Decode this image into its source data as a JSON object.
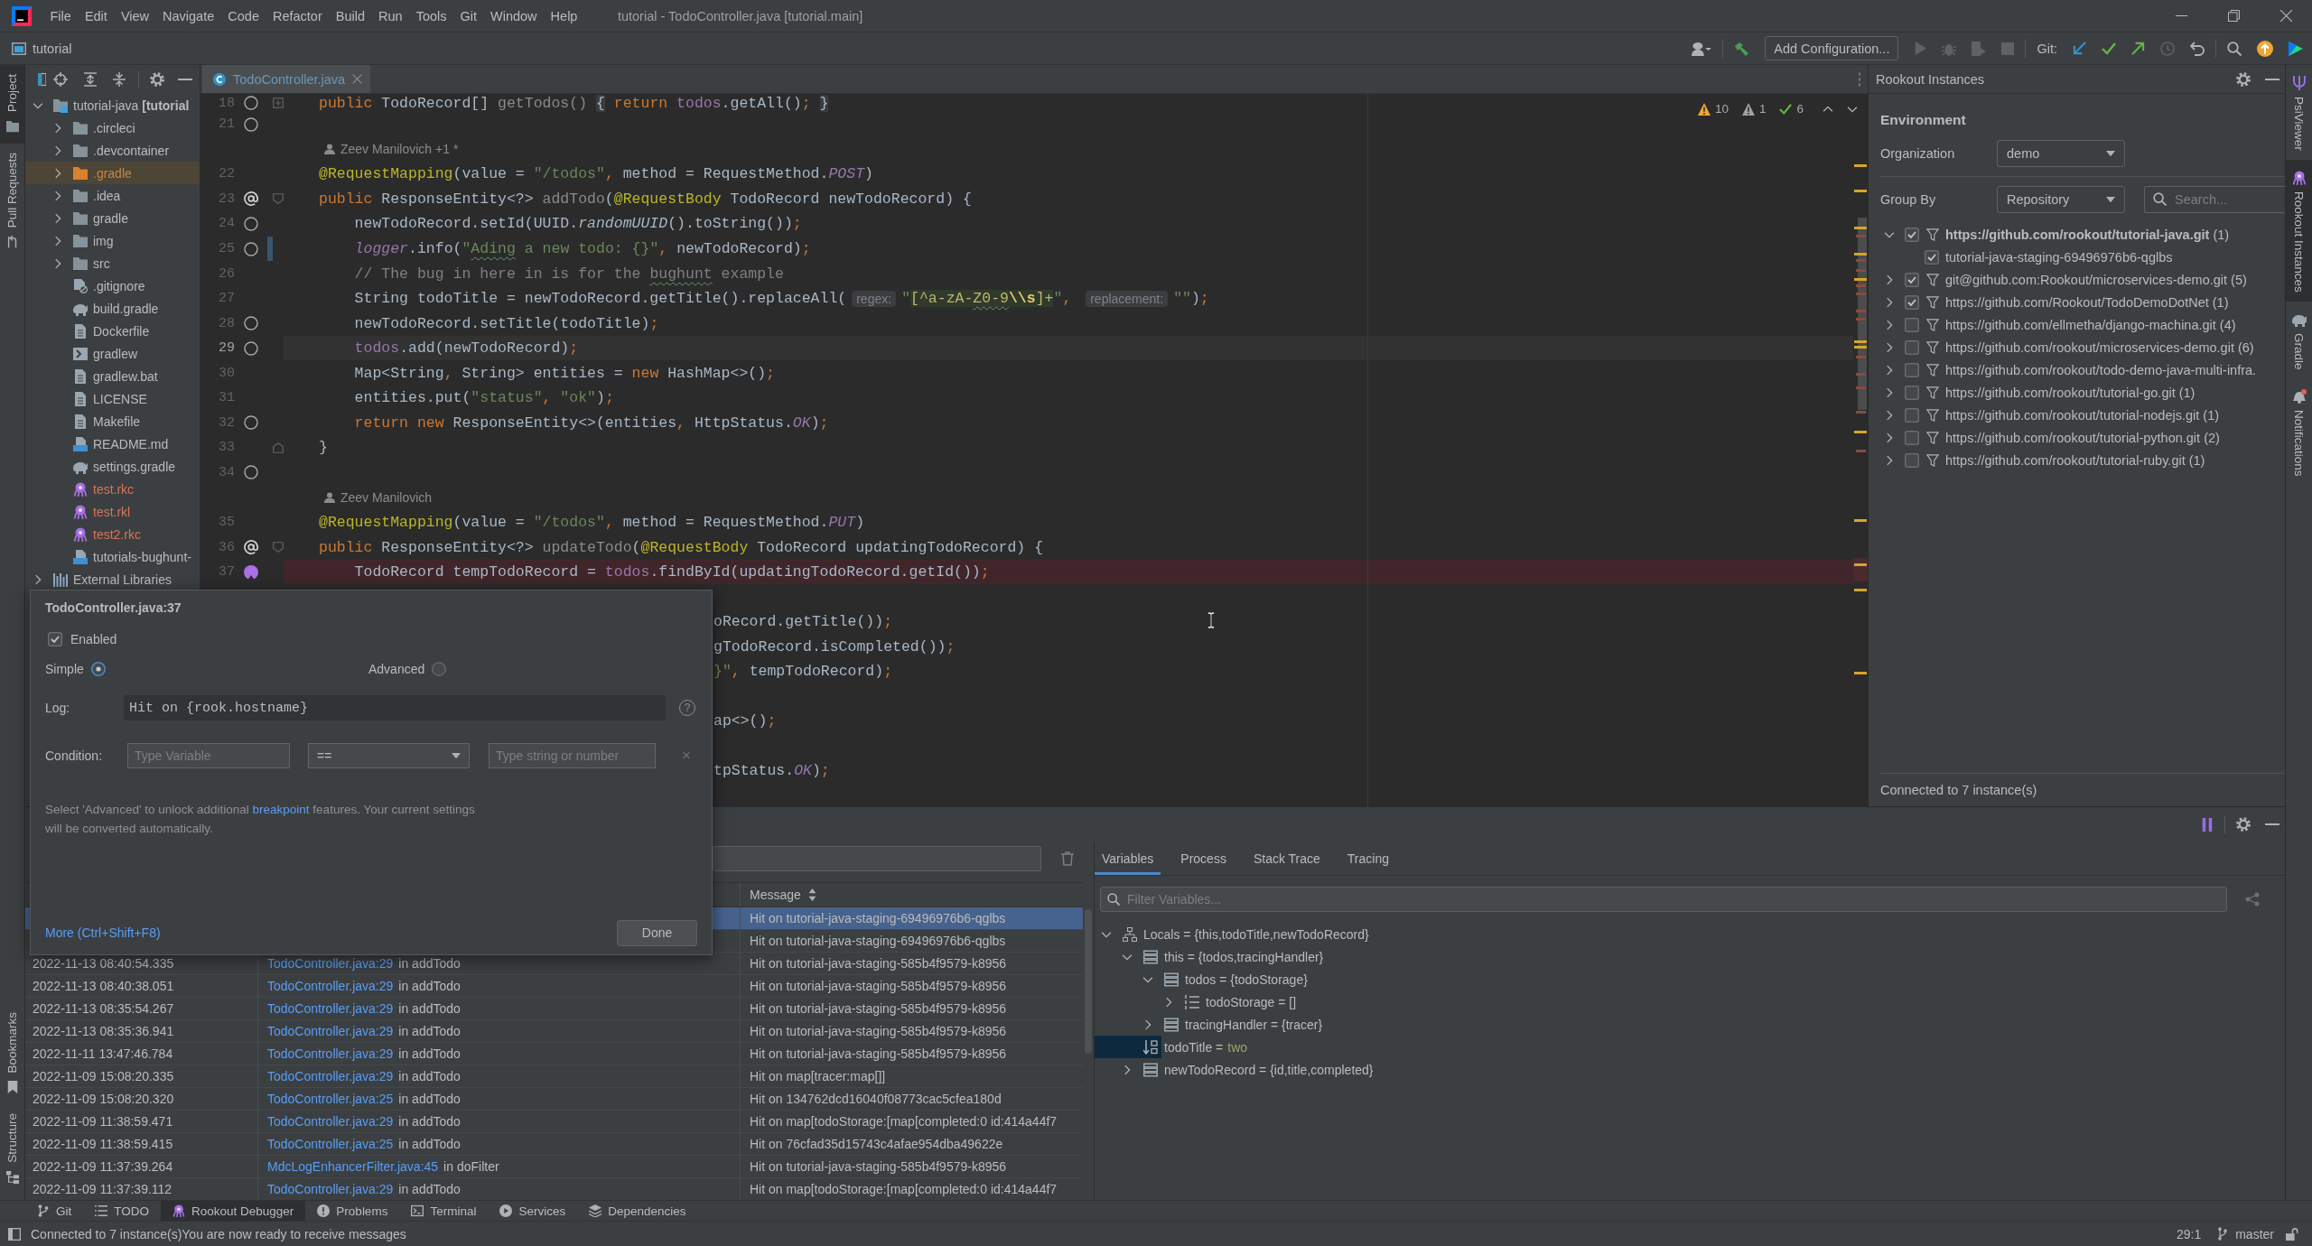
{
  "title_bar": {
    "menu": [
      "File",
      "Edit",
      "View",
      "Navigate",
      "Code",
      "Refactor",
      "Build",
      "Run",
      "Tools",
      "Git",
      "Window",
      "Help"
    ],
    "title": "tutorial - TodoController.java [tutorial.main]"
  },
  "nav_bar": {
    "project": "tutorial",
    "run_configuration": "Add Configuration...",
    "git_label": "Git:"
  },
  "left_strip": {
    "top": [
      {
        "label": "Project",
        "kind": "project",
        "selected": true
      },
      {
        "label": "Pull Requests",
        "kind": "pull-requests",
        "selected": false
      }
    ],
    "bottom": [
      {
        "label": "Bookmarks",
        "kind": "bookmarks",
        "selected": false
      },
      {
        "label": "Structure",
        "kind": "structure",
        "selected": false
      }
    ]
  },
  "project_panel": {
    "tree": [
      {
        "label": "tutorial-java **[tutorial**",
        "kind": "module",
        "expanded": true,
        "excluded": false,
        "unversioned": false,
        "children": [
          {
            "label": ".circleci",
            "kind": "folder",
            "expanded": false,
            "excluded": false,
            "unversioned": false
          },
          {
            "label": ".devcontainer",
            "kind": "folder",
            "expanded": false,
            "excluded": false,
            "unversioned": false
          },
          {
            "label": ".gradle",
            "kind": "folder",
            "expanded": false,
            "excluded": true,
            "unversioned": false
          },
          {
            "label": ".idea",
            "kind": "folder",
            "expanded": false,
            "excluded": false,
            "unversioned": false
          },
          {
            "label": "gradle",
            "kind": "folder",
            "expanded": false,
            "excluded": false,
            "unversioned": false
          },
          {
            "label": "img",
            "kind": "folder",
            "expanded": false,
            "excluded": false,
            "unversioned": false
          },
          {
            "label": "src",
            "kind": "folder",
            "expanded": false,
            "excluded": false,
            "unversioned": false
          },
          {
            "label": ".gitignore",
            "kind": "ignore-file",
            "excluded": false,
            "unversioned": false
          },
          {
            "label": "build.gradle",
            "kind": "gradle",
            "excluded": false,
            "unversioned": false
          },
          {
            "label": "Dockerfile",
            "kind": "text",
            "excluded": false,
            "unversioned": false
          },
          {
            "label": "gradlew",
            "kind": "script",
            "excluded": false,
            "unversioned": false
          },
          {
            "label": "gradlew.bat",
            "kind": "text",
            "excluded": false,
            "unversioned": false
          },
          {
            "label": "LICENSE",
            "kind": "text",
            "excluded": false,
            "unversioned": false
          },
          {
            "label": "Makefile",
            "kind": "text",
            "excluded": false,
            "unversioned": false
          },
          {
            "label": "README.md",
            "kind": "markdown",
            "excluded": false,
            "unversioned": false
          },
          {
            "label": "settings.gradle",
            "kind": "gradle",
            "excluded": false,
            "unversioned": false
          },
          {
            "label": "test.rkc",
            "kind": "rookout",
            "excluded": false,
            "unversioned": true
          },
          {
            "label": "test.rkl",
            "kind": "rookout",
            "excluded": false,
            "unversioned": true
          },
          {
            "label": "test2.rkc",
            "kind": "rookout",
            "excluded": false,
            "unversioned": true
          },
          {
            "label": "tutorials-bughunt-",
            "kind": "markdown",
            "excluded": false,
            "unversioned": false
          }
        ]
      },
      {
        "label": "External Libraries",
        "kind": "library",
        "expanded": false,
        "excluded": false,
        "unversioned": false
      }
    ]
  },
  "editor": {
    "tab": {
      "label": "TodoController.java",
      "modified": true
    },
    "inspections": [
      {
        "kind": "warning",
        "count": "10"
      },
      {
        "kind": "weak-warning",
        "count": "1"
      },
      {
        "kind": "ok",
        "count": "6"
      }
    ],
    "lines": [
      {
        "kind": "code",
        "number": "18",
        "gutter": {
          "kind": "ring"
        },
        "fold": {
          "kind": "collapsed"
        },
        "segments": [
          {
            "text": "public ",
            "kind": "keyword"
          },
          {
            "text": "TodoRecord[] ",
            "kind": "plain"
          },
          {
            "text": "getTodos() ",
            "kind": "unused"
          },
          {
            "text": "{",
            "kind": "folded"
          },
          {
            "text": " return ",
            "kind": "keyword"
          },
          {
            "text": "todos",
            "kind": "field"
          },
          {
            "text": ".getAll()",
            "kind": "plain"
          },
          {
            "text": "; ",
            "kind": "keyword"
          },
          {
            "text": "}",
            "kind": "folded"
          }
        ]
      },
      {
        "kind": "code",
        "number": "21",
        "gutter": {
          "kind": "ring"
        }
      },
      {
        "kind": "author",
        "text": "Zeev Manilovich +1 *"
      },
      {
        "kind": "code",
        "number": "22",
        "segments": [
          {
            "text": "@RequestMapping",
            "kind": "annotation"
          },
          {
            "text": "(value = ",
            "kind": "plain"
          },
          {
            "text": "\"/todos\"",
            "kind": "string"
          },
          {
            "text": ", ",
            "kind": "keyword"
          },
          {
            "text": "method = RequestMethod.",
            "kind": "plain"
          },
          {
            "text": "POST",
            "kind": "constant"
          },
          {
            "text": ")",
            "kind": "plain"
          }
        ]
      },
      {
        "kind": "code",
        "number": "23",
        "gutter": {
          "kind": "mapping"
        },
        "fold": {
          "kind": "start"
        },
        "segments": [
          {
            "text": "public ",
            "kind": "keyword"
          },
          {
            "text": "ResponseEntity<?> ",
            "kind": "plain"
          },
          {
            "text": "addTodo",
            "kind": "unused"
          },
          {
            "text": "(",
            "kind": "plain"
          },
          {
            "text": "@RequestBody ",
            "kind": "annotation"
          },
          {
            "text": "TodoRecord newTodoRecord) {",
            "kind": "plain"
          }
        ]
      },
      {
        "kind": "code",
        "number": "24",
        "gutter": {
          "kind": "ring"
        },
        "segments": [
          {
            "text": "    newTodoRecord.setId(UUID.",
            "kind": "plain"
          },
          {
            "text": "randomUUID",
            "kind": "static-call"
          },
          {
            "text": "().toString())",
            "kind": "plain"
          },
          {
            "text": ";",
            "kind": "keyword"
          }
        ]
      },
      {
        "kind": "code",
        "number": "25",
        "gutter": {
          "kind": "ring"
        },
        "vcs": {
          "kind": "modified"
        },
        "segments": [
          {
            "text": "    logger",
            "kind": "constant"
          },
          {
            "text": ".info(",
            "kind": "plain"
          },
          {
            "text": "\"",
            "kind": "string"
          },
          {
            "text": "Ading",
            "kind": "string-typo"
          },
          {
            "text": " a new todo: {}\"",
            "kind": "string"
          },
          {
            "text": ", ",
            "kind": "keyword"
          },
          {
            "text": "newTodoRecord)",
            "kind": "plain"
          },
          {
            "text": ";",
            "kind": "keyword"
          }
        ]
      },
      {
        "kind": "code",
        "number": "26",
        "segments": [
          {
            "text": "    // The bug in here in is for the ",
            "kind": "comment"
          },
          {
            "text": "bughunt",
            "kind": "comment-typo"
          },
          {
            "text": " example",
            "kind": "comment"
          }
        ]
      },
      {
        "kind": "code",
        "number": "27",
        "segments": [
          {
            "text": "    String todoTitle = newTodoRecord.getTitle().replaceAll(",
            "kind": "plain"
          },
          {
            "text": "regex:",
            "kind": "hint"
          },
          {
            "text": "\"",
            "kind": "string"
          },
          {
            "text": "[^a-zA-",
            "kind": "regex"
          },
          {
            "text": "Z0-9",
            "kind": "regex-typo"
          },
          {
            "text": "\\\\s",
            "kind": "regex-escape"
          },
          {
            "text": "]+",
            "kind": "regex"
          },
          {
            "text": "\"",
            "kind": "string"
          },
          {
            "text": ", ",
            "kind": "keyword"
          },
          {
            "text": "replacement:",
            "kind": "hint"
          },
          {
            "text": "\"\"",
            "kind": "string"
          },
          {
            "text": ")",
            "kind": "plain"
          },
          {
            "text": ";",
            "kind": "keyword"
          }
        ]
      },
      {
        "kind": "code",
        "number": "28",
        "gutter": {
          "kind": "ring"
        },
        "segments": [
          {
            "text": "    newTodoRecord.setTitle(todoTitle)",
            "kind": "plain"
          },
          {
            "text": ";",
            "kind": "keyword"
          }
        ]
      },
      {
        "kind": "code",
        "number": "29",
        "gutter": {
          "kind": "ring"
        },
        "highlight": {
          "kind": "caret"
        },
        "segments": [
          {
            "text": "    todos",
            "kind": "field"
          },
          {
            "text": ".add(newTodoRecord)",
            "kind": "plain"
          },
          {
            "text": ";",
            "kind": "keyword"
          }
        ]
      },
      {
        "kind": "code",
        "number": "30",
        "segments": [
          {
            "text": "    Map<String",
            "kind": "plain"
          },
          {
            "text": ", ",
            "kind": "keyword"
          },
          {
            "text": "String> entities = ",
            "kind": "plain"
          },
          {
            "text": "new ",
            "kind": "keyword"
          },
          {
            "text": "HashMap<>()",
            "kind": "plain"
          },
          {
            "text": ";",
            "kind": "keyword"
          }
        ]
      },
      {
        "kind": "code",
        "number": "31",
        "segments": [
          {
            "text": "    entities.put(",
            "kind": "plain"
          },
          {
            "text": "\"status\"",
            "kind": "string"
          },
          {
            "text": ", ",
            "kind": "keyword"
          },
          {
            "text": "\"ok\"",
            "kind": "string"
          },
          {
            "text": ")",
            "kind": "plain"
          },
          {
            "text": ";",
            "kind": "keyword"
          }
        ]
      },
      {
        "kind": "code",
        "number": "32",
        "gutter": {
          "kind": "ring"
        },
        "segments": [
          {
            "text": "    return new ",
            "kind": "keyword"
          },
          {
            "text": "ResponseEntity<>(entities",
            "kind": "plain"
          },
          {
            "text": ", ",
            "kind": "keyword"
          },
          {
            "text": "HttpStatus.",
            "kind": "plain"
          },
          {
            "text": "OK",
            "kind": "constant"
          },
          {
            "text": ")",
            "kind": "plain"
          },
          {
            "text": ";",
            "kind": "keyword"
          }
        ]
      },
      {
        "kind": "code",
        "number": "33",
        "fold": {
          "kind": "end"
        },
        "segments": [
          {
            "text": "}",
            "kind": "plain"
          }
        ]
      },
      {
        "kind": "code",
        "number": "34",
        "gutter": {
          "kind": "ring"
        }
      },
      {
        "kind": "author",
        "text": "Zeev Manilovich"
      },
      {
        "kind": "code",
        "number": "35",
        "segments": [
          {
            "text": "@RequestMapping",
            "kind": "annotation"
          },
          {
            "text": "(value = ",
            "kind": "plain"
          },
          {
            "text": "\"/todos\"",
            "kind": "string"
          },
          {
            "text": ", ",
            "kind": "keyword"
          },
          {
            "text": "method = RequestMethod.",
            "kind": "plain"
          },
          {
            "text": "PUT",
            "kind": "constant"
          },
          {
            "text": ")",
            "kind": "plain"
          }
        ]
      },
      {
        "kind": "code",
        "number": "36",
        "gutter": {
          "kind": "mapping"
        },
        "fold": {
          "kind": "start"
        },
        "segments": [
          {
            "text": "public ",
            "kind": "keyword"
          },
          {
            "text": "ResponseEntity<?> ",
            "kind": "plain"
          },
          {
            "text": "updateTodo",
            "kind": "unused"
          },
          {
            "text": "(",
            "kind": "plain"
          },
          {
            "text": "@RequestBody ",
            "kind": "annotation"
          },
          {
            "text": "TodoRecord updatingTodoRecord) {",
            "kind": "plain"
          }
        ]
      },
      {
        "kind": "code",
        "number": "37",
        "gutter": {
          "kind": "breakpoint"
        },
        "highlight": {
          "kind": "breakpoint"
        },
        "segments": [
          {
            "text": "    TodoRecord tempTodoRecord = ",
            "kind": "plain"
          },
          {
            "text": "todos",
            "kind": "field"
          },
          {
            "text": ".findById(updatingTodoRecord.getId())",
            "kind": "plain"
          },
          {
            "text": ";",
            "kind": "keyword"
          }
        ]
      },
      {
        "kind": "covered"
      },
      {
        "kind": "covered",
        "segments": [
          {
            "text": "oRecord.getTitle())",
            "kind": "plain"
          },
          {
            "text": ";",
            "kind": "keyword"
          }
        ]
      },
      {
        "kind": "covered",
        "segments": [
          {
            "text": "gTodoRecord.isCompleted())",
            "kind": "plain"
          },
          {
            "text": ";",
            "kind": "keyword"
          }
        ]
      },
      {
        "kind": "covered",
        "segments": [
          {
            "text": "}\"",
            "kind": "string"
          },
          {
            "text": ", ",
            "kind": "keyword"
          },
          {
            "text": "tempTodoRecord)",
            "kind": "plain"
          },
          {
            "text": ";",
            "kind": "keyword"
          }
        ]
      },
      {
        "kind": "covered"
      },
      {
        "kind": "covered",
        "segments": [
          {
            "text": "ap<>()",
            "kind": "plain"
          },
          {
            "text": ";",
            "kind": "keyword"
          }
        ]
      },
      {
        "kind": "covered"
      },
      {
        "kind": "covered",
        "segments": [
          {
            "text": "tpStatus.",
            "kind": "plain"
          },
          {
            "text": "OK",
            "kind": "constant"
          },
          {
            "text": ")",
            "kind": "plain"
          },
          {
            "text": ";",
            "kind": "keyword"
          }
        ]
      }
    ]
  },
  "breakpoint_popup": {
    "title": "TodoController.java:37",
    "enabled": {
      "label": "Enabled",
      "checked": true
    },
    "modes": [
      {
        "label": "Simple",
        "selected": true
      },
      {
        "label": "Advanced",
        "selected": false
      }
    ],
    "log": {
      "label": "Log:",
      "value": "Hit on {rook.hostname}"
    },
    "help": "?",
    "condition": {
      "label": "Condition:",
      "variable": {
        "placeholder": "Type Variable"
      },
      "operator": "==",
      "value": {
        "placeholder": "Type string or number"
      }
    },
    "clear": "×",
    "note": {
      "before": "Select 'Advanced' to unlock additional ",
      "link": "breakpoint",
      "after": " features. Your current settings will be converted automatically."
    },
    "more_link": "More (Ctrl+Shift+F8)",
    "done": "Done"
  },
  "rookout_panel": {
    "title": "Rookout Instances",
    "section": "Environment",
    "organization": {
      "label": "Organization",
      "value": "demo"
    },
    "group_by": {
      "label": "Group By",
      "value": "Repository"
    },
    "search": {
      "placeholder": "Search..."
    },
    "repositories": [
      {
        "label": "**https://github.com/rookout/tutorial-java.git** (1)",
        "checked": true,
        "expanded": true,
        "children": [
          {
            "label": "tutorial-java-staging-69496976b6-qglbs",
            "checked": true
          }
        ]
      },
      {
        "label": "git@github.com:Rookout/microservices-demo.git (5)",
        "checked": true,
        "expanded": false
      },
      {
        "label": "https://github.com/Rookout/TodoDemoDotNet (1)",
        "checked": true,
        "expanded": false
      },
      {
        "label": "https://github.com/ellmetha/django-machina.git (4)",
        "checked": false,
        "expanded": false
      },
      {
        "label": "https://github.com/rookout/microservices-demo.git (6)",
        "checked": false,
        "expanded": false
      },
      {
        "label": "https://github.com/rookout/todo-demo-java-multi-infra.",
        "checked": false,
        "expanded": false
      },
      {
        "label": "https://github.com/rookout/tutorial-go.git (1)",
        "checked": false,
        "expanded": false
      },
      {
        "label": "https://github.com/rookout/tutorial-nodejs.git (1)",
        "checked": false,
        "expanded": false
      },
      {
        "label": "https://github.com/rookout/tutorial-python.git (2)",
        "checked": false,
        "expanded": false
      },
      {
        "label": "https://github.com/rookout/tutorial-ruby.git (1)",
        "checked": false,
        "expanded": false
      }
    ],
    "status": "Connected to 7 instance(s)"
  },
  "right_strip": [
    {
      "label": "PsiViewer",
      "kind": "psi",
      "selected": false,
      "alert": false
    },
    {
      "label": "Rookout Instances",
      "kind": "rookout",
      "selected": true,
      "alert": false
    },
    {
      "label": "Gradle",
      "kind": "gradle",
      "selected": false,
      "alert": false
    },
    {
      "label": "Notifications",
      "kind": "notifications",
      "selected": false,
      "alert": true
    }
  ],
  "debugger": {
    "log": {
      "message_header": "Message",
      "rows": [
        {
          "message": "Hit on tutorial-java-staging-69496976b6-qglbs",
          "selected": true
        },
        {
          "message": "Hit on tutorial-java-staging-69496976b6-qglbs",
          "selected": false
        },
        {
          "time": "2022-11-13 08:40:54.335",
          "file": "TodoController.java:29",
          "function": "in addTodo",
          "message": "Hit on tutorial-java-staging-585b4f9579-k8956",
          "selected": false
        },
        {
          "time": "2022-11-13 08:40:38.051",
          "file": "TodoController.java:29",
          "function": "in addTodo",
          "message": "Hit on tutorial-java-staging-585b4f9579-k8956",
          "selected": false
        },
        {
          "time": "2022-11-13 08:35:54.267",
          "file": "TodoController.java:29",
          "function": "in addTodo",
          "message": "Hit on tutorial-java-staging-585b4f9579-k8956",
          "selected": false
        },
        {
          "time": "2022-11-13 08:35:36.941",
          "file": "TodoController.java:29",
          "function": "in addTodo",
          "message": "Hit on tutorial-java-staging-585b4f9579-k8956",
          "selected": false
        },
        {
          "time": "2022-11-11 13:47:46.784",
          "file": "TodoController.java:29",
          "function": "in addTodo",
          "message": "Hit on tutorial-java-staging-585b4f9579-k8956",
          "selected": false
        },
        {
          "time": "2022-11-09 15:08:20.335",
          "file": "TodoController.java:29",
          "function": "in addTodo",
          "message": "Hit on map[tracer:map[]]",
          "selected": false
        },
        {
          "time": "2022-11-09 15:08:20.320",
          "file": "TodoController.java:25",
          "function": "in addTodo",
          "message": "Hit on 134762dcd16040f08773cac5cfea180d",
          "selected": false
        },
        {
          "time": "2022-11-09 11:38:59.471",
          "file": "TodoController.java:29",
          "function": "in addTodo",
          "message": "Hit on map[todoStorage:[map[completed:0 id:414a44f7",
          "selected": false
        },
        {
          "time": "2022-11-09 11:38:59.415",
          "file": "TodoController.java:25",
          "function": "in addTodo",
          "message": "Hit on 76cfad35d15743c4afae954dba49622e",
          "selected": false
        },
        {
          "time": "2022-11-09 11:37:39.264",
          "file": "MdcLogEnhancerFilter.java:45",
          "function": "in doFilter",
          "message": "Hit on tutorial-java-staging-585b4f9579-k8956",
          "selected": false
        },
        {
          "time": "2022-11-09 11:37:39.112",
          "file": "TodoController.java:29",
          "function": "in addTodo",
          "message": "Hit on map[todoStorage:[map[completed:0 id:414a44f7",
          "selected": false
        }
      ]
    },
    "variables": {
      "tabs": [
        {
          "label": "Variables",
          "selected": true
        },
        {
          "label": "Process",
          "selected": false
        },
        {
          "label": "Stack Trace",
          "selected": false
        },
        {
          "label": "Tracing",
          "selected": false
        }
      ],
      "filter": {
        "placeholder": "Filter Variables..."
      },
      "tree": [
        {
          "text": "Locals = {this,todoTitle,newTodoRecord}",
          "kind": "scope",
          "expanded": true,
          "selected": false,
          "children": [
            {
              "text": "this = {todos,tracingHandler}",
              "kind": "object",
              "expanded": true,
              "selected": false,
              "children": [
                {
                  "text": "todos = {todoStorage}",
                  "kind": "object",
                  "expanded": true,
                  "selected": false,
                  "children": [
                    {
                      "text": "todoStorage = []",
                      "kind": "array",
                      "expanded": false,
                      "selected": false
                    }
                  ]
                },
                {
                  "text": "tracingHandler = {tracer}",
                  "kind": "object",
                  "expanded": false,
                  "selected": false
                }
              ]
            },
            {
              "text": "todoTitle =",
              "value": "two",
              "kind": "string",
              "selected": true
            },
            {
              "text": "newTodoRecord = {id,title,completed}",
              "kind": "object",
              "expanded": false,
              "selected": false
            }
          ]
        }
      ]
    }
  },
  "tool_tabs": [
    {
      "label": "Git",
      "kind": "git",
      "selected": false
    },
    {
      "label": "TODO",
      "kind": "todo",
      "selected": false
    },
    {
      "label": "Rookout Debugger",
      "kind": "rookout",
      "selected": true
    },
    {
      "label": "Problems",
      "kind": "problems",
      "selected": false
    },
    {
      "label": "Terminal",
      "kind": "terminal",
      "selected": false
    },
    {
      "label": "Services",
      "kind": "services",
      "selected": false
    },
    {
      "label": "Dependencies",
      "kind": "dependencies",
      "selected": false
    }
  ],
  "status_bar": {
    "message": "Connected to 7 instance(s)You are now ready to receive messages",
    "position": "29:1",
    "branch": "master"
  }
}
